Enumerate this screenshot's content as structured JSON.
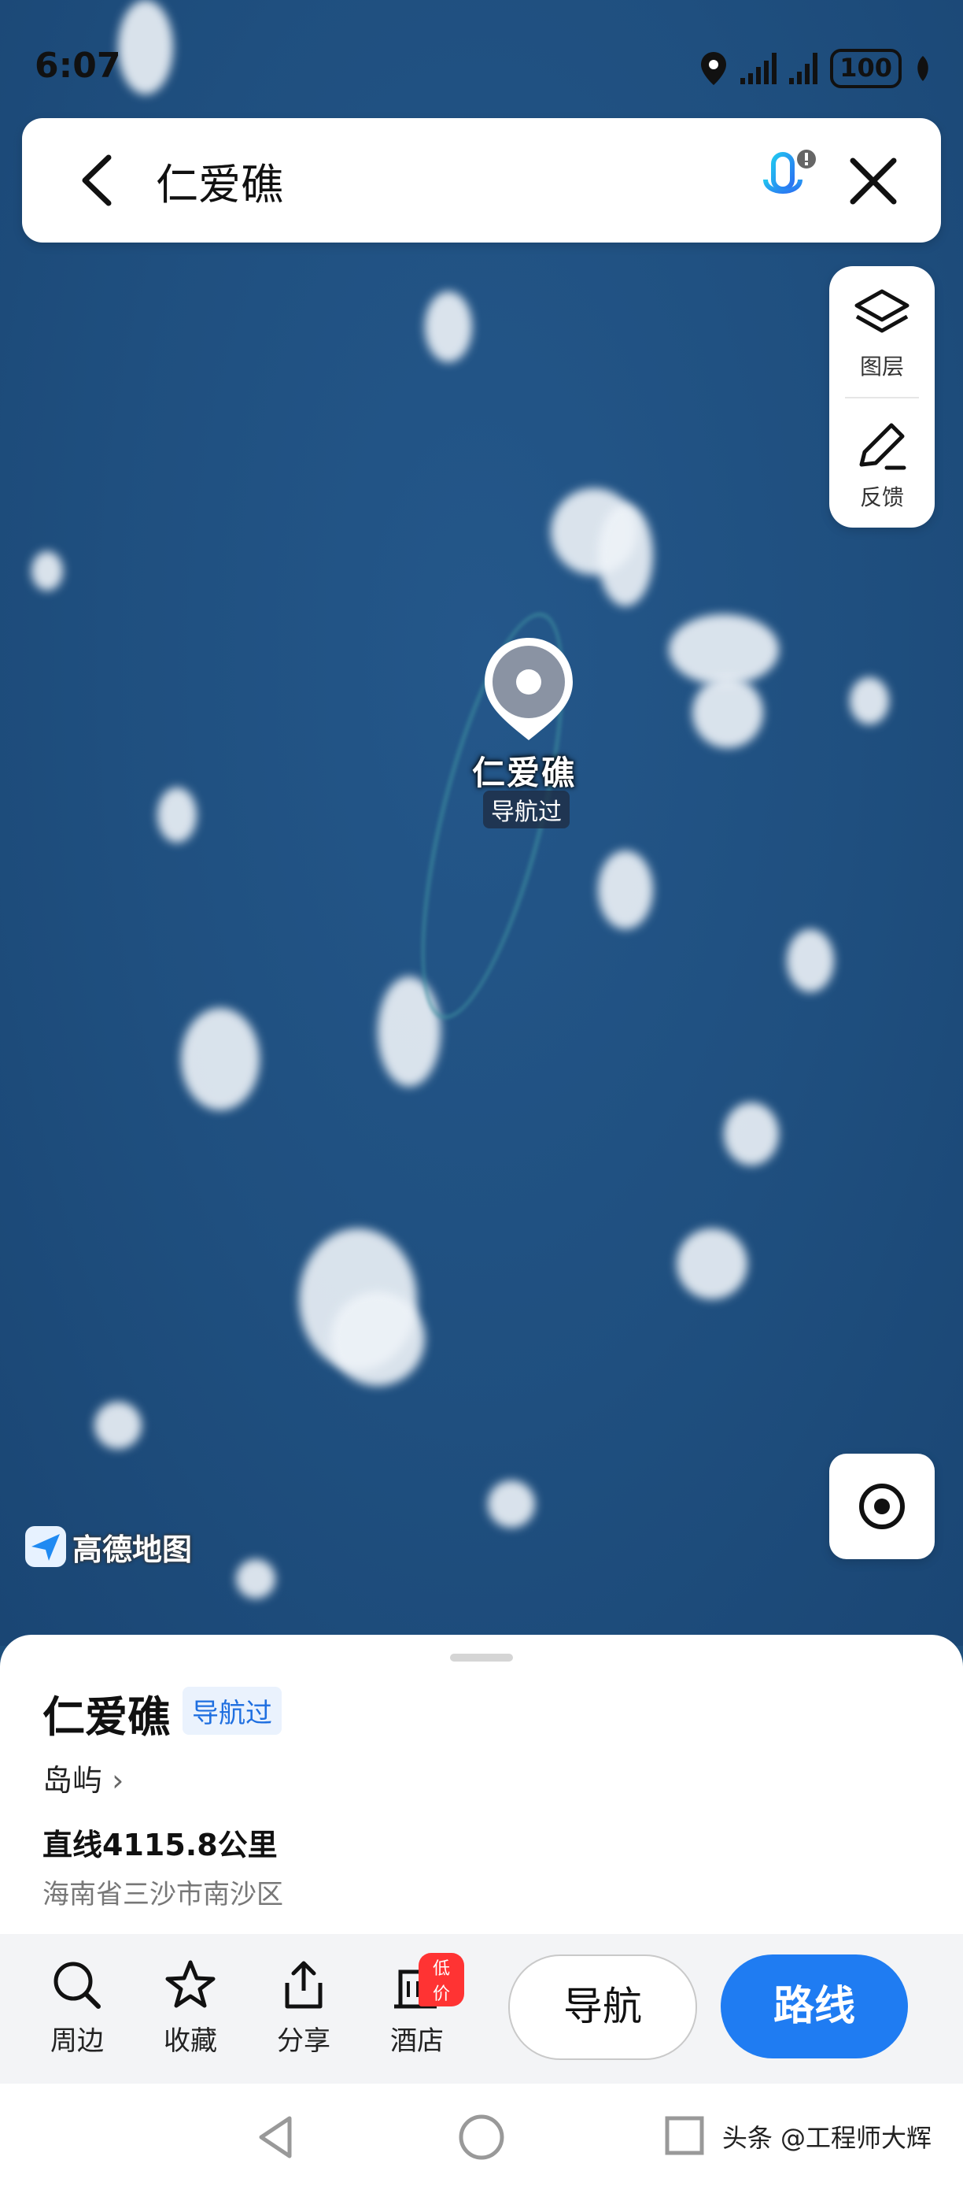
{
  "status_bar": {
    "time": "6:07",
    "battery": "100"
  },
  "search": {
    "query": "仁爱礁"
  },
  "map_tools": {
    "layers_label": "图层",
    "feedback_label": "反馈"
  },
  "marker": {
    "title": "仁爱礁",
    "subtitle": "导航过"
  },
  "logo": {
    "text": "高德地图"
  },
  "place": {
    "name": "仁爱礁",
    "badge": "导航过",
    "type": "岛屿",
    "distance": "直线4115.8公里",
    "address": "海南省三沙市南沙区"
  },
  "actions": {
    "nearby": "周边",
    "favorite": "收藏",
    "share": "分享",
    "hotel": "酒店",
    "hotel_badge": "低价",
    "navigate": "导航",
    "route": "路线"
  },
  "watermark": "头条 @工程师大辉",
  "colors": {
    "accent": "#1f7cf2",
    "ocean": "#1f4f7f",
    "badge_red": "#ff3333"
  }
}
